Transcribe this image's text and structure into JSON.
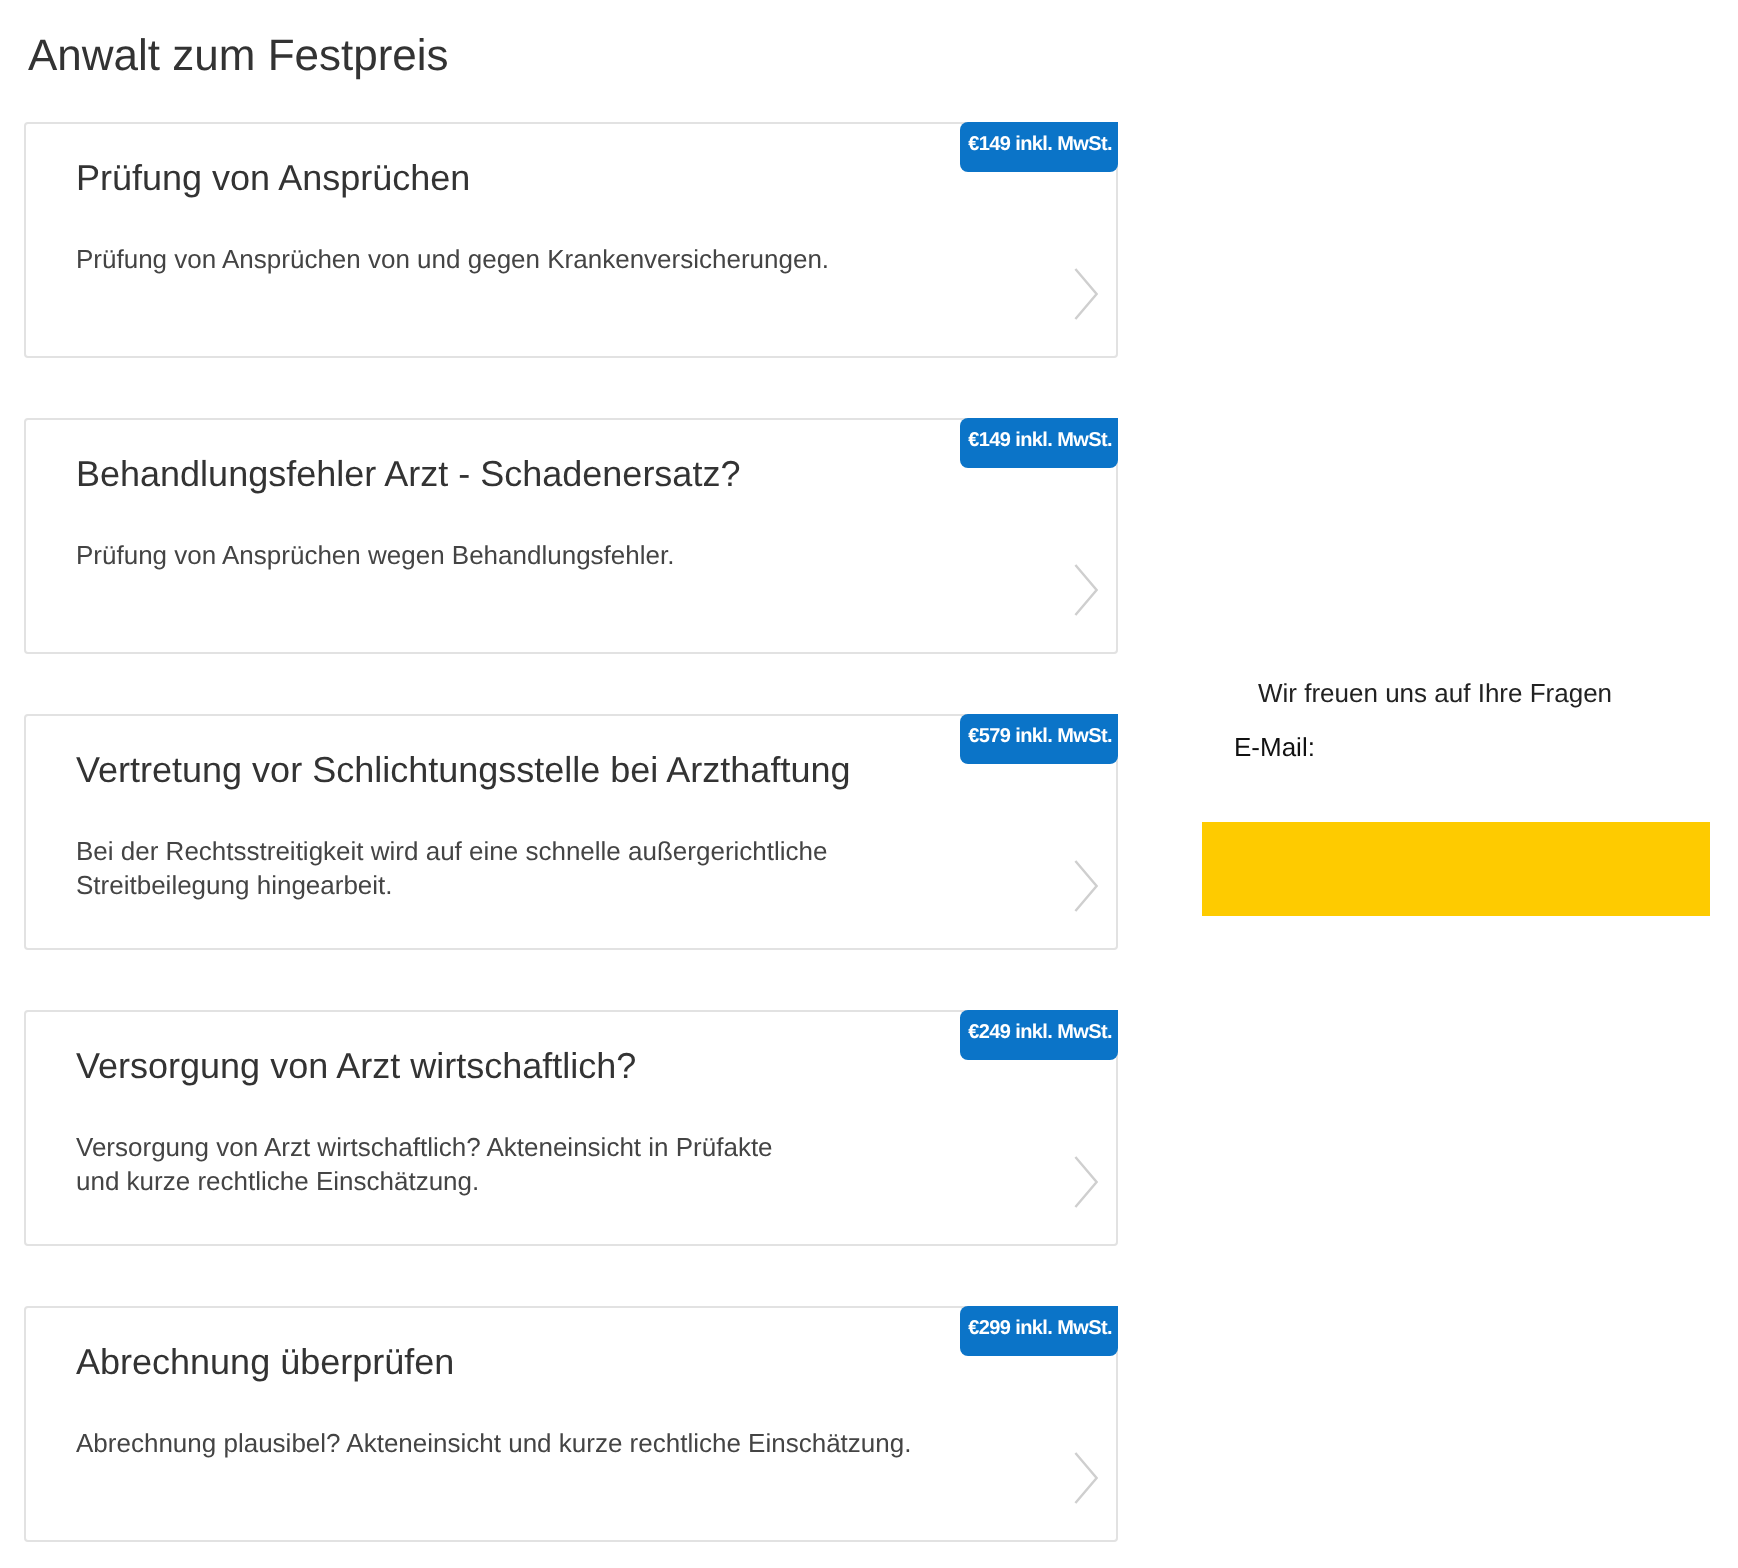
{
  "page": {
    "title": "Anwalt zum Festpreis"
  },
  "offers": [
    {
      "title": "Prüfung von Ansprüchen",
      "price": "€149 inkl. MwSt.",
      "description": [
        "Prüfung von Ansprüchen von und gegen Krankenversicherungen."
      ]
    },
    {
      "title": "Behandlungsfehler Arzt - Schadenersatz?",
      "price": "€149 inkl. MwSt.",
      "description": [
        "Prüfung von Ansprüchen wegen Behandlungsfehler."
      ]
    },
    {
      "title": "Vertretung vor Schlichtungsstelle bei Arzthaftung",
      "price": "€579 inkl. MwSt.",
      "description": [
        "Bei der Rechtsstreitigkeit wird auf eine schnelle außergerichtliche",
        "Streitbeilegung hingearbeit."
      ]
    },
    {
      "title": "Versorgung von Arzt wirtschaftlich?",
      "price": "€249 inkl. MwSt.",
      "description": [
        "Versorgung von Arzt wirtschaftlich? Akteneinsicht in Prüfakte",
        "und kurze rechtliche Einschätzung."
      ]
    },
    {
      "title": "Abrechnung überprüfen",
      "price": "€299 inkl. MwSt.",
      "description": [
        "Abrechnung plausibel? Akteneinsicht und kurze rechtliche Einschätzung."
      ]
    }
  ],
  "contact": {
    "heading": "Wir freuen uns auf Ihre Fragen",
    "email_label": "E-Mail:"
  }
}
